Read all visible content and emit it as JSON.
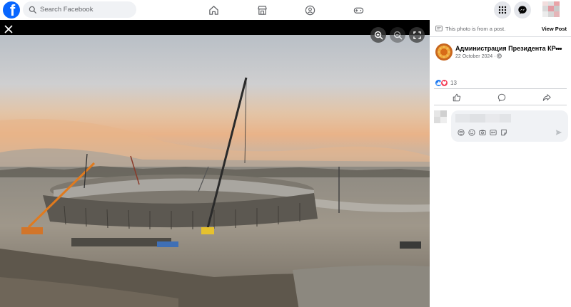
{
  "topbar": {
    "logo_letter": "f",
    "search_placeholder": "Search Facebook",
    "nav_icons": [
      "home-icon",
      "marketplace-icon",
      "groups-icon",
      "gaming-icon"
    ],
    "right_icons": [
      "menu-grid-icon",
      "messenger-icon"
    ],
    "brand_color": "#0866ff"
  },
  "viewer": {
    "controls": [
      "zoom-in-icon",
      "zoom-out-icon",
      "fullscreen-icon"
    ]
  },
  "panel": {
    "post_note": "This photo is from a post.",
    "view_post_label": "View Post",
    "author_name": "Администрация Президента КР",
    "post_date": "22 October 2024 ·",
    "reaction_count": "13",
    "reactions": [
      "like-icon",
      "love-icon"
    ],
    "actions": [
      "like-action-icon",
      "comment-action-icon",
      "share-action-icon"
    ],
    "composer_icons": [
      "avatar-sticker-icon",
      "emoji-icon",
      "camera-icon",
      "gif-icon",
      "sticker-icon"
    ]
  }
}
